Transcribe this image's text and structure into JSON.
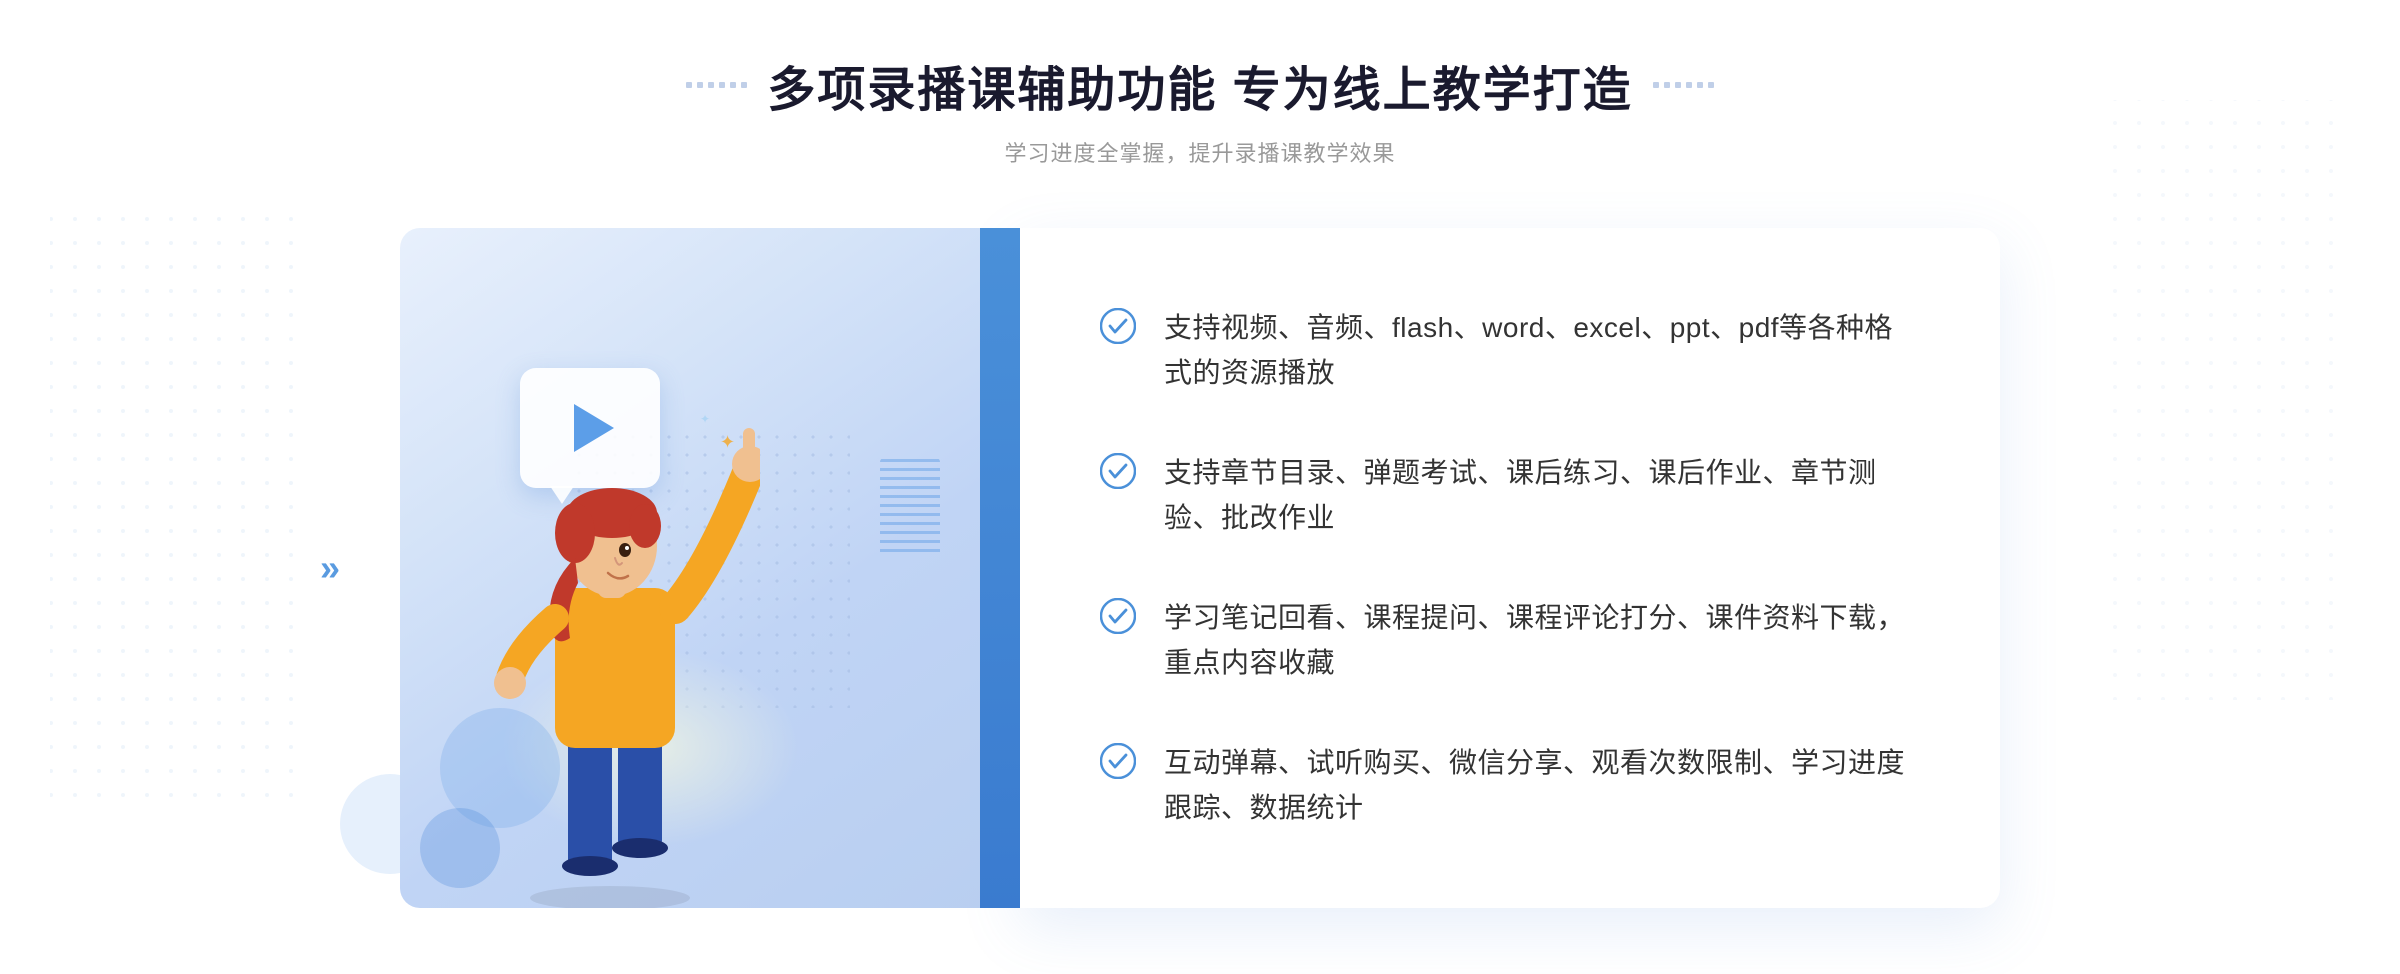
{
  "header": {
    "title": "多项录播课辅助功能 专为线上教学打造",
    "subtitle": "学习进度全掌握，提升录播课教学效果"
  },
  "features": [
    {
      "id": "feature-1",
      "text": "支持视频、音频、flash、word、excel、ppt、pdf等各种格式的资源播放"
    },
    {
      "id": "feature-2",
      "text": "支持章节目录、弹题考试、课后练习、课后作业、章节测验、批改作业"
    },
    {
      "id": "feature-3",
      "text": "学习笔记回看、课程提问、课程评论打分、课件资料下载，重点内容收藏"
    },
    {
      "id": "feature-4",
      "text": "互动弹幕、试听购买、微信分享、观看次数限制、学习进度跟踪、数据统计"
    }
  ],
  "colors": {
    "accent": "#4a90d9",
    "check": "#4a90d9",
    "title": "#1a1a2e",
    "subtitle": "#999999",
    "text": "#333333"
  }
}
